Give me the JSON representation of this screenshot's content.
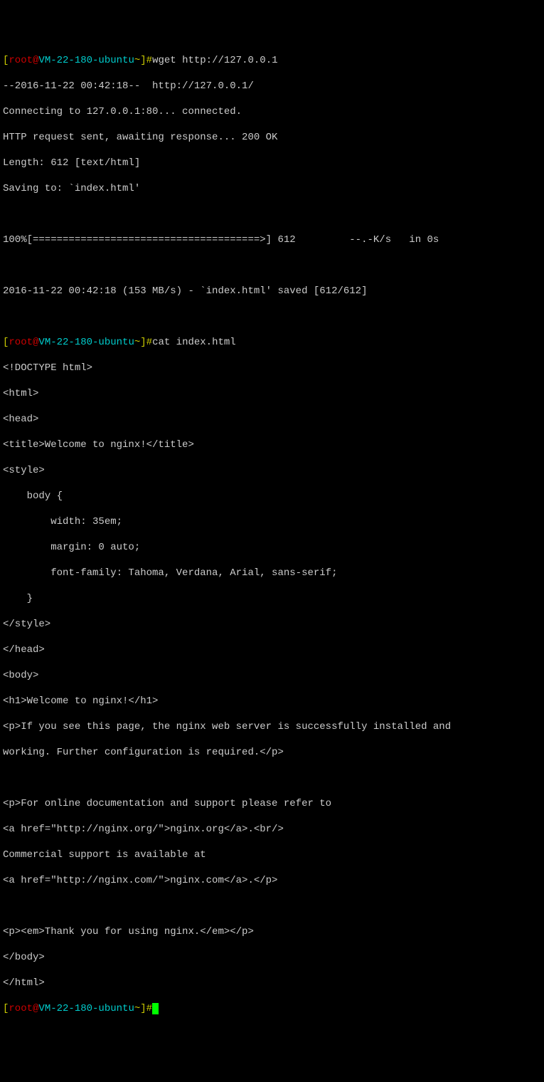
{
  "p1": {
    "bracket_open": "[",
    "user": "root@",
    "host": "VM-22-180-ubuntu",
    "path": "~",
    "bracket_close": "]",
    "hash": "#"
  },
  "cmd1": "wget http://127.0.0.1",
  "wget": {
    "l1": "--2016-11-22 00:42:18--  http://127.0.0.1/",
    "l2": "Connecting to 127.0.0.1:80... connected.",
    "l3": "HTTP request sent, awaiting response... 200 OK",
    "l4": "Length: 612 [text/html]",
    "l5": "Saving to: `index.html'",
    "l6": "100%[======================================>] 612         --.-K/s   in 0s",
    "l7": "2016-11-22 00:42:18 (153 MB/s) - `index.html' saved [612/612]"
  },
  "cmd2": "cat index.html",
  "cat": {
    "l1": "<!DOCTYPE html>",
    "l2": "<html>",
    "l3": "<head>",
    "l4": "<title>Welcome to nginx!</title>",
    "l5": "<style>",
    "l6": "    body {",
    "l7": "        width: 35em;",
    "l8": "        margin: 0 auto;",
    "l9": "        font-family: Tahoma, Verdana, Arial, sans-serif;",
    "l10": "    }",
    "l11": "</style>",
    "l12": "</head>",
    "l13": "<body>",
    "l14": "<h1>Welcome to nginx!</h1>",
    "l15": "<p>If you see this page, the nginx web server is successfully installed and",
    "l16": "working. Further configuration is required.</p>",
    "l17": "<p>For online documentation and support please refer to",
    "l18": "<a href=\"http://nginx.org/\">nginx.org</a>.<br/>",
    "l19": "Commercial support is available at",
    "l20": "<a href=\"http://nginx.com/\">nginx.com</a>.</p>",
    "l21": "<p><em>Thank you for using nginx.</em></p>",
    "l22": "</body>",
    "l23": "</html>"
  }
}
